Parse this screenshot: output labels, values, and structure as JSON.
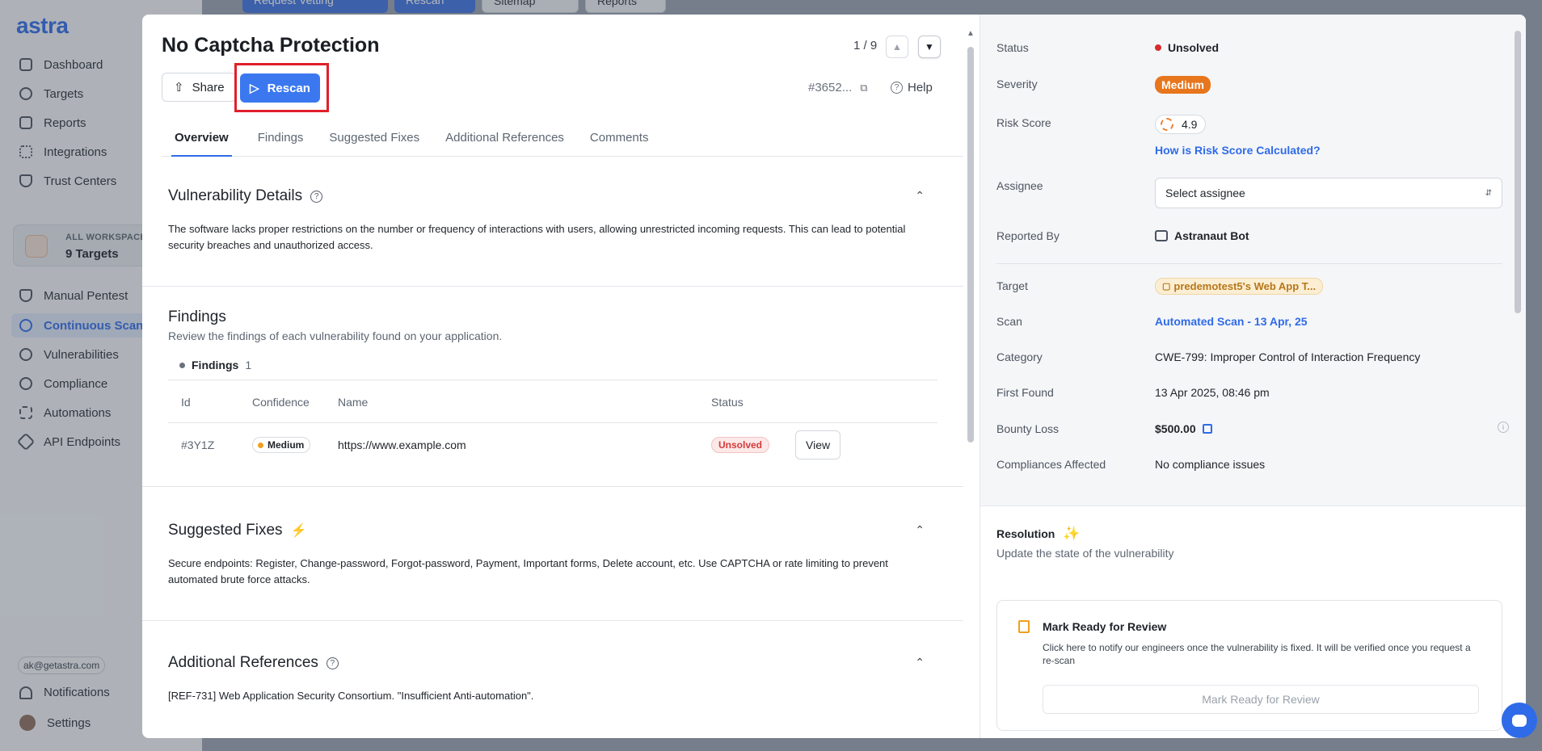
{
  "app": {
    "logo": "astra",
    "nav": [
      {
        "label": "Dashboard",
        "icon": "grid-icon"
      },
      {
        "label": "Targets",
        "icon": "target-icon"
      },
      {
        "label": "Reports",
        "icon": "document-icon"
      },
      {
        "label": "Integrations",
        "icon": "integrations-icon"
      },
      {
        "label": "Trust Centers",
        "icon": "shield-icon"
      }
    ],
    "workspace": {
      "label": "ALL WORKSPACES",
      "count": "9 Targets"
    },
    "nav2": [
      {
        "label": "Manual Pentest",
        "icon": "shield-icon"
      },
      {
        "label": "Continuous Scans",
        "icon": "bug-icon"
      },
      {
        "label": "Vulnerabilities",
        "icon": "vulnerability-icon"
      },
      {
        "label": "Compliance",
        "icon": "check-circle-icon"
      },
      {
        "label": "Automations",
        "icon": "automation-icon"
      },
      {
        "label": "API Endpoints",
        "icon": "api-icon"
      }
    ],
    "user_email": "ak@getastra.com",
    "notifications": "Notifications",
    "settings": "Settings",
    "bg_actions": [
      "Request Vetting",
      "Rescan",
      "Sitemap",
      "Reports"
    ]
  },
  "modal": {
    "title": "No Captcha Protection",
    "pager": "1 / 9",
    "share": "Share",
    "rescan": "Rescan",
    "ref_id": "#3652...",
    "help": "Help",
    "tabs": [
      "Overview",
      "Findings",
      "Suggested Fixes",
      "Additional References",
      "Comments"
    ],
    "vuln_details": {
      "title": "Vulnerability Details",
      "text": "The software lacks proper restrictions on the number or frequency of interactions with users, allowing unrestricted incoming requests. This can lead to potential security breaches and unauthorized access."
    },
    "findings": {
      "title": "Findings",
      "subtitle": "Review the findings of each vulnerability found on your application.",
      "chip_label": "Findings",
      "chip_count": "1",
      "columns": [
        "Id",
        "Confidence",
        "Name",
        "Status"
      ],
      "rows": [
        {
          "id": "#3Y1Z",
          "confidence": "Medium",
          "name": "https://www.example.com",
          "status": "Unsolved",
          "action": "View"
        }
      ]
    },
    "suggested_fixes": {
      "title": "Suggested Fixes",
      "text": "Secure endpoints: Register, Change-password, Forgot-password, Payment, Important forms, Delete account, etc. Use CAPTCHA or rate limiting to prevent automated brute force attacks."
    },
    "additional_refs": {
      "title": "Additional References",
      "text": "[REF-731] Web Application Security Consortium. \"Insufficient Anti-automation\"."
    }
  },
  "details": {
    "status": {
      "label": "Status",
      "value": "Unsolved"
    },
    "severity": {
      "label": "Severity",
      "value": "Medium"
    },
    "risk": {
      "label": "Risk Score",
      "value": "4.9",
      "link": "How is Risk Score Calculated?"
    },
    "assignee": {
      "label": "Assignee",
      "value": "Select assignee"
    },
    "reported_by": {
      "label": "Reported By",
      "value": "Astranaut Bot"
    },
    "target": {
      "label": "Target",
      "value": "predemotest5's Web App T..."
    },
    "scan": {
      "label": "Scan",
      "value": "Automated Scan - 13 Apr, 25"
    },
    "category": {
      "label": "Category",
      "value": "CWE-799: Improper Control of Interaction Frequency"
    },
    "first_found": {
      "label": "First Found",
      "value": "13 Apr 2025, 08:46 pm"
    },
    "bounty": {
      "label": "Bounty Loss",
      "value": "$500.00"
    },
    "compliances": {
      "label": "Compliances Affected",
      "value": "No compliance issues"
    }
  },
  "resolution": {
    "title": "Resolution",
    "subtitle": "Update the state of the vulnerability",
    "card_title": "Mark Ready for Review",
    "card_text": "Click here to notify our engineers once the vulnerability is fixed. It will be verified once you request a re-scan",
    "card_button": "Mark Ready for Review"
  },
  "colors": {
    "accent": "#3b78f0",
    "danger": "#d72c2c",
    "warning": "#e7761c",
    "highlight": "#e0202a"
  }
}
